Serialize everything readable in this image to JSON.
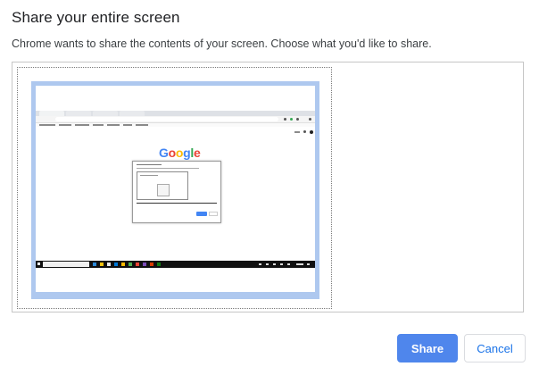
{
  "dialog": {
    "title": "Share your entire screen",
    "subtitle": "Chrome wants to share the contents of your screen. Choose what you'd like to share.",
    "share_label": "Share",
    "cancel_label": "Cancel"
  },
  "thumbnail": {
    "logo_letters": [
      "G",
      "o",
      "o",
      "g",
      "l",
      "e"
    ],
    "highlight_color": "#aec8ef"
  },
  "colors": {
    "accent": "#4f86ec",
    "cancel_text": "#1a73e8",
    "google_blue": "#4285f4",
    "google_red": "#ea4335",
    "google_yellow": "#fbbc05",
    "google_green": "#34a853"
  }
}
